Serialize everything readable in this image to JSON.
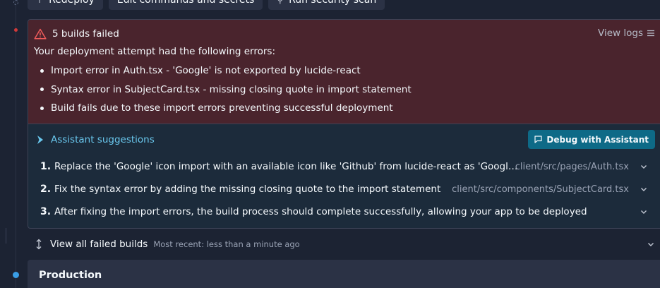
{
  "toolbar": {
    "redeploy_label": "Redeploy",
    "edit_label": "Edit commands and secrets",
    "scan_label": "Run security scan"
  },
  "error_panel": {
    "title": "5 builds failed",
    "view_logs_label": "View logs",
    "intro": "Your deployment attempt had the following errors:",
    "errors": [
      "Import error in Auth.tsx - 'Google' is not exported by lucide-react",
      "Syntax error in SubjectCard.tsx - missing closing quote in import statement",
      "Build fails due to these import errors preventing successful deployment"
    ]
  },
  "assistant": {
    "title": "Assistant suggestions",
    "debug_label": "Debug with Assistant",
    "suggestions": [
      {
        "num": "1.",
        "text": "Replace the 'Google' icon import with an available icon like 'Github' from lucide-react as 'Google' is not available in the package",
        "path": "client/src/pages/Auth.tsx"
      },
      {
        "num": "2.",
        "text": "Fix the syntax error by adding the missing closing quote to the import statement",
        "path": "client/src/components/SubjectCard.tsx"
      },
      {
        "num": "3.",
        "text": "After fixing the import errors, the build process should complete successfully, allowing your app to be deployed",
        "path": ""
      }
    ]
  },
  "failed_builds": {
    "label": "View all failed builds",
    "subtitle": "Most recent: less than a minute ago"
  },
  "production": {
    "title": "Production"
  },
  "colors": {
    "background": "#1c2333",
    "error_bg": "#4a242d",
    "accent": "#69c7ed",
    "debug_button": "#0e6a87",
    "production_dot": "#3a9ee6",
    "error_dot": "#d13a3a"
  }
}
